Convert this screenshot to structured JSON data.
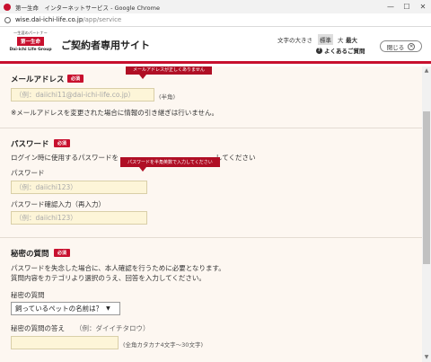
{
  "browser": {
    "window_title": "第一生命　インターネットサービス - Google Chrome",
    "url_host": "wise.dai-ichi-life.co.jp",
    "url_path": "/app/service",
    "minimize_glyph": "—",
    "maximize_glyph": "☐",
    "close_glyph": "✕"
  },
  "header": {
    "logo_tagline": "一生涯のパートナー",
    "logo_name": "第一生命",
    "logo_group": "Dai-ichi Life Group",
    "site_title": "ご契約者専用サイト",
    "font_size_label": "文字の大きさ",
    "font_size_options": [
      "標準",
      "大",
      "最大"
    ],
    "faq_label": "よくあるご質問",
    "close_label": "閉じる"
  },
  "email_section": {
    "heading": "メールアドレス",
    "required_badge": "必須",
    "error_tooltip": "メールアドレスが正しくありません",
    "placeholder": "（例：daiichi11@dai-ichi-life.co.jp）",
    "hint": "(半角)",
    "note": "※メールアドレスを変更された場合に情報の引き継ぎは行いません。"
  },
  "password_section": {
    "heading": "パスワード",
    "required_badge": "必須",
    "description_start": "ログイン時に使用するパスワードを",
    "description_end": "してください",
    "error_tooltip": "パスワードを半角英数で入力してください",
    "password_label": "パスワード",
    "password_placeholder": "（例：daiichi123）",
    "confirm_label": "パスワード確認入力（再入力）",
    "confirm_placeholder": "（例：daiichi123）"
  },
  "secret_section": {
    "heading": "秘密の質問",
    "required_badge": "必須",
    "description_line1": "パスワードを失念した場合に、本人確認を行うために必要となります。",
    "description_line2": "質問内容をカテゴリより選択のうえ、回答を入力してください。",
    "question_label": "秘密の質問",
    "question_selected": "飼っているペットの名前は？",
    "answer_label": "秘密の質問の答え",
    "answer_example": "（例：ダイイチタロウ）",
    "answer_hint": "(全角カタカナ4文字〜30文字)"
  },
  "colors": {
    "brand_red": "#c8102e",
    "input_bg": "#fdf5d8",
    "page_bg": "#fdf7f1"
  }
}
